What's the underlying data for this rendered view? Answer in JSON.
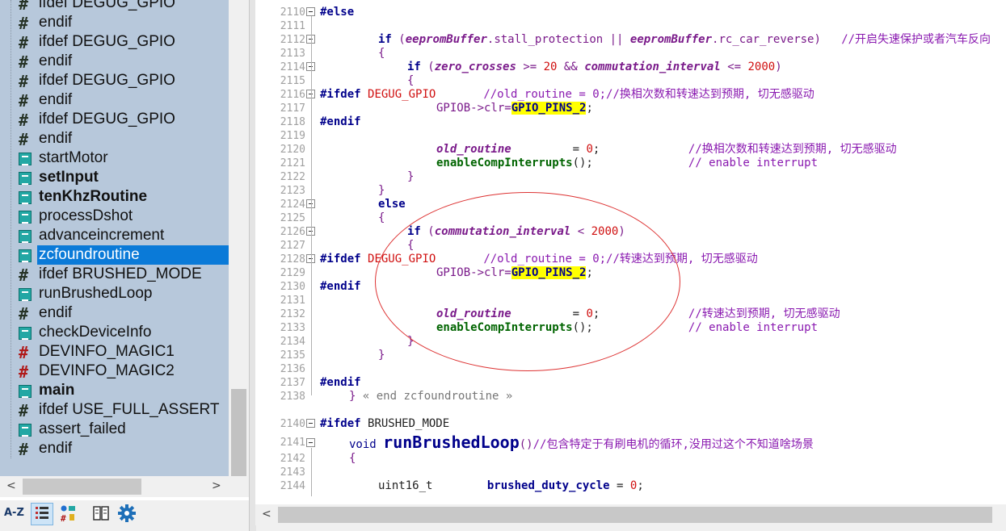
{
  "symbols": [
    {
      "label": "ifdef DEGUG_GPIO",
      "icon": "green"
    },
    {
      "label": "endif",
      "icon": "green"
    },
    {
      "label": "ifdef DEGUG_GPIO",
      "icon": "green"
    },
    {
      "label": "endif",
      "icon": "green"
    },
    {
      "label": "ifdef DEGUG_GPIO",
      "icon": "green"
    },
    {
      "label": "endif",
      "icon": "green"
    },
    {
      "label": "ifdef DEGUG_GPIO",
      "icon": "green"
    },
    {
      "label": "endif",
      "icon": "green"
    },
    {
      "label": "startMotor",
      "icon": "func"
    },
    {
      "label": "setInput",
      "icon": "func",
      "bold": true
    },
    {
      "label": "tenKhzRoutine",
      "icon": "func",
      "bold": true
    },
    {
      "label": "processDshot",
      "icon": "func"
    },
    {
      "label": "advanceincrement",
      "icon": "func"
    },
    {
      "label": "zcfoundroutine",
      "icon": "func",
      "selected": true
    },
    {
      "label": "ifdef BRUSHED_MODE",
      "icon": "green"
    },
    {
      "label": "runBrushedLoop",
      "icon": "func"
    },
    {
      "label": "endif",
      "icon": "green"
    },
    {
      "label": "checkDeviceInfo",
      "icon": "func"
    },
    {
      "label": "DEVINFO_MAGIC1",
      "icon": "red"
    },
    {
      "label": "DEVINFO_MAGIC2",
      "icon": "red"
    },
    {
      "label": "main",
      "icon": "func",
      "bold": true
    },
    {
      "label": "ifdef USE_FULL_ASSERT",
      "icon": "green"
    },
    {
      "label": "assert_failed",
      "icon": "func"
    },
    {
      "label": "endif",
      "icon": "green"
    }
  ],
  "toolbar": {
    "sort_label": "A-Z"
  },
  "scroll": {
    "left_arrow": "<",
    "right_arrow": ">",
    "down_arrow": "∨"
  },
  "lines": [
    "2110",
    "2111",
    "2112",
    "2113",
    "2114",
    "2115",
    "2116",
    "2117",
    "2118",
    "2119",
    "2120",
    "2121",
    "2122",
    "2123",
    "2124",
    "2125",
    "2126",
    "2127",
    "2128",
    "2129",
    "2130",
    "2131",
    "2132",
    "2133",
    "2134",
    "2135",
    "2136",
    "2137",
    "2138",
    "2140",
    "2141",
    "2142",
    "2143",
    "2144"
  ],
  "code": {
    "l2110_kw": "#else",
    "l2112_if": "if",
    "l2112_a": "(",
    "l2112_b": "eepromBuffer",
    "l2112_c": ".stall_protection ",
    "l2112_d": "||",
    "l2112_e": " eepromBuffer",
    "l2112_f": ".rc_car_reverse)",
    "l2112_cm": "//开启失速保护或者汽车反向",
    "l2113": "{",
    "l2114_if": "if",
    "l2114_a": "(",
    "l2114_b": "zero_crosses",
    "l2114_c": " >= ",
    "l2114_n": "20",
    "l2114_d": " && ",
    "l2114_e": "commutation_interval",
    "l2114_f": " <= ",
    "l2114_n2": "2000",
    "l2114_g": ")",
    "l2115": "{",
    "l2116_pp": "#ifdef",
    "l2116_mac": "DEGUG_GPIO",
    "l2116_cm": "//old_routine = 0;//换相次数和转速达到预期, 切无感驱动",
    "l2117_a": "GPIOB->clr=",
    "l2117_hl": "GPIO_PINS_2",
    "l2117_b": ";",
    "l2118": "#endif",
    "l2120_id": "old_routine",
    "l2120_eq": "= ",
    "l2120_n": "0",
    "l2120_s": ";",
    "l2120_cm": "//换相次数和转速达到预期, 切无感驱动",
    "l2121_fn": "enableCompInterrupts",
    "l2121_p": "();",
    "l2121_cm": "// enable interrupt",
    "l2122": "}",
    "l2123": "}",
    "l2124": "else",
    "l2125": "{",
    "l2126_if": "if",
    "l2126_a": "(",
    "l2126_b": "commutation_interval",
    "l2126_c": " < ",
    "l2126_n": "2000",
    "l2126_d": ")",
    "l2127": "{",
    "l2128_pp": "#ifdef",
    "l2128_mac": "DEGUG_GPIO",
    "l2128_cm": "//old_routine = 0;//转速达到预期, 切无感驱动",
    "l2129_a": "GPIOB->clr=",
    "l2129_hl": "GPIO_PINS_2",
    "l2129_b": ";",
    "l2130": "#endif",
    "l2132_id": "old_routine",
    "l2132_eq": "= ",
    "l2132_n": "0",
    "l2132_s": ";",
    "l2132_cm": "//转速达到预期, 切无感驱动",
    "l2133_fn": "enableCompInterrupts",
    "l2133_p": "();",
    "l2133_cm": "// enable interrupt",
    "l2134": "}",
    "l2135": "}",
    "l2137": "#endif",
    "l2138_b": "}",
    "l2138_t": "« end zcfoundroutine »",
    "l2140_pp": "#ifdef",
    "l2140_mac": "BRUSHED_MODE",
    "l2141_void": "void",
    "l2141_fn": "runBrushedLoop",
    "l2141_p": "()",
    "l2141_cm": "//包含特定于有刷电机的循环,没用过这个不知道啥场景",
    "l2142": "{",
    "l2144_t": "uint16_t",
    "l2144_id": "brushed_duty_cycle",
    "l2144_eq": " = ",
    "l2144_n": "0",
    "l2144_s": ";"
  }
}
